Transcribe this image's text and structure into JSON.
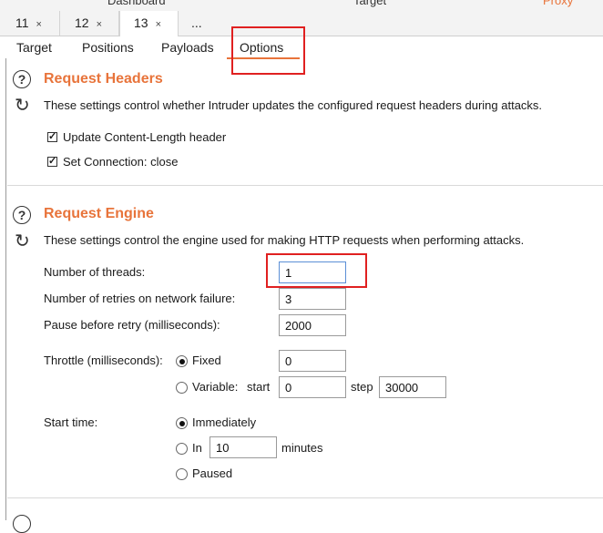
{
  "top_tabs": {
    "dashboard": "Dashboard",
    "target": "Target",
    "proxy": "Proxy"
  },
  "intruder_tabs": [
    {
      "label": "11",
      "close": "×"
    },
    {
      "label": "12",
      "close": "×"
    },
    {
      "label": "13",
      "close": "×"
    },
    {
      "label": "..."
    }
  ],
  "sub_tabs": [
    "Target",
    "Positions",
    "Payloads",
    "Options"
  ],
  "active_sub_tab": "Options",
  "request_headers": {
    "title": "Request Headers",
    "description": "These settings control whether Intruder updates the configured request headers during attacks.",
    "options": [
      {
        "label": "Update Content-Length header",
        "checked": true
      },
      {
        "label": "Set Connection: close",
        "checked": true
      }
    ]
  },
  "request_engine": {
    "title": "Request Engine",
    "description": "These settings control the engine used for making HTTP requests when performing attacks.",
    "threads_label": "Number of threads:",
    "threads_value": "1",
    "retries_label": "Number of retries on network failure:",
    "retries_value": "3",
    "pause_label": "Pause before retry (milliseconds):",
    "pause_value": "2000",
    "throttle_label": "Throttle (milliseconds):",
    "throttle_fixed_label": "Fixed",
    "throttle_fixed_value": "0",
    "throttle_variable_label": "Variable:",
    "start_label": "start",
    "start_value": "0",
    "step_label": "step",
    "step_value": "30000",
    "throttle_mode": "Fixed",
    "start_time_label": "Start time:",
    "immediately_label": "Immediately",
    "in_label": "In",
    "in_value": "10",
    "minutes_label": "minutes",
    "paused_label": "Paused",
    "start_time_mode": "Immediately"
  },
  "icons": {
    "help": "help-circle-icon",
    "refresh": "refresh-icon",
    "close": "close-icon"
  },
  "colors": {
    "accent": "#e8743b",
    "highlight": "#e02020",
    "focus": "#5b8fd6"
  }
}
